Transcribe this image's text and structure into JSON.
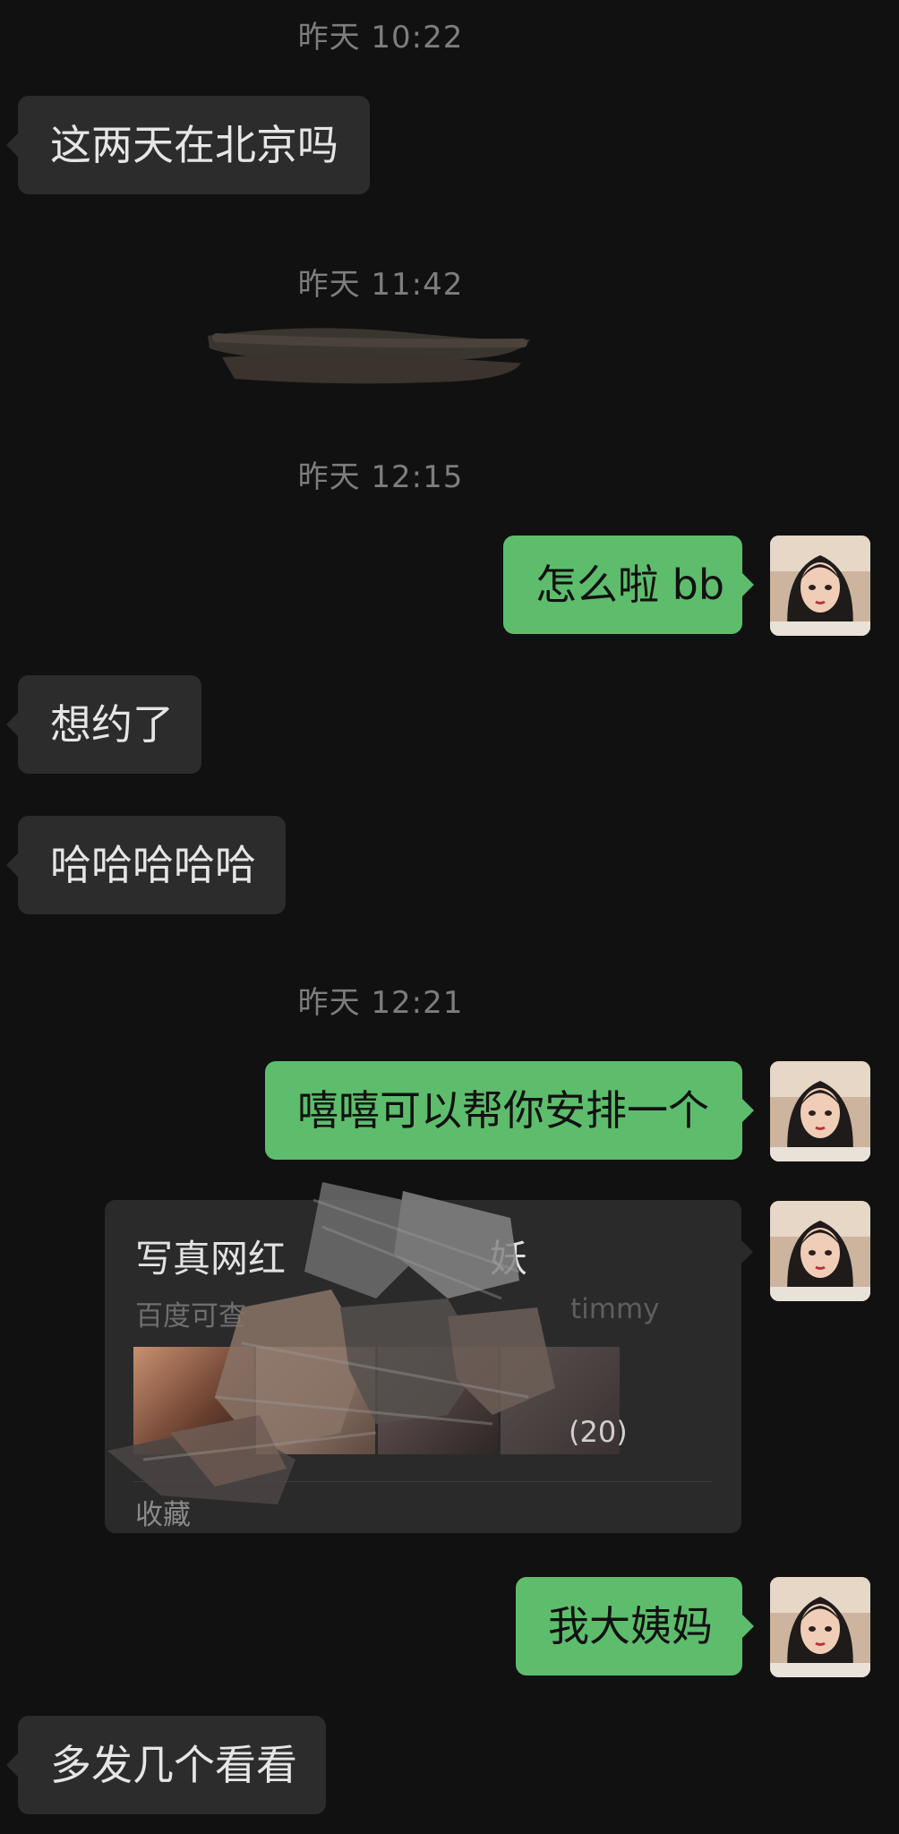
{
  "timestamps": [
    "昨天 10:22",
    "昨天 11:42",
    "昨天 12:15",
    "昨天 12:21"
  ],
  "messages": {
    "m1": "这两天在北京吗",
    "m2": "怎么啦 bb",
    "m3": "想约了",
    "m4": "哈哈哈哈哈",
    "m5": "嘻嘻可以帮你安排一个",
    "m6": "我大姨妈",
    "m7": "多发几个看看"
  },
  "card": {
    "title_left": "写真网红",
    "title_right": "妖",
    "subtitle_left": "百度可查",
    "subtitle_right": "timmy",
    "image_count": "(20)",
    "source": "收藏"
  },
  "colors": {
    "background": "#111111",
    "incoming_bubble": "#2c2c2c",
    "outgoing_bubble": "#5dbd6c",
    "timestamp": "#7d7d7d"
  },
  "icons": {
    "avatar": "anime-girl-avatar"
  }
}
